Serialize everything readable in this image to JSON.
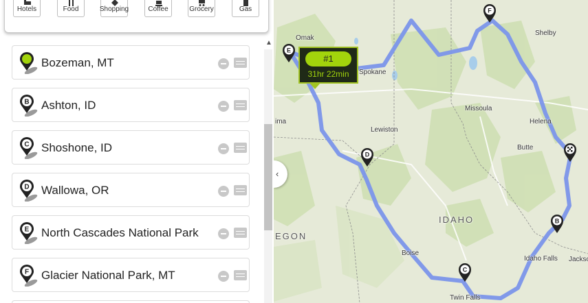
{
  "categories": [
    {
      "label": "Hotels",
      "icon": "bed-icon"
    },
    {
      "label": "Food",
      "icon": "fork-knife-icon"
    },
    {
      "label": "Shopping",
      "icon": "shopping-tag-icon"
    },
    {
      "label": "Coffee",
      "icon": "coffee-cup-icon"
    },
    {
      "label": "Grocery",
      "icon": "cart-icon"
    },
    {
      "label": "Gas",
      "icon": "gas-pump-icon"
    }
  ],
  "stops": [
    {
      "marker": "",
      "name": "Bozeman, MT"
    },
    {
      "marker": "B",
      "name": "Ashton, ID"
    },
    {
      "marker": "C",
      "name": "Shoshone, ID"
    },
    {
      "marker": "D",
      "name": "Wallowa, OR"
    },
    {
      "marker": "E",
      "name": "North Cascades National Park"
    },
    {
      "marker": "F",
      "name": "Glacier National Park, MT"
    }
  ],
  "map": {
    "labels": {
      "omak": "Omak",
      "spokane": "Spokane",
      "shelby": "Shelby",
      "missoula": "Missoula",
      "lewiston": "Lewiston",
      "helena": "Helena",
      "butte": "Butte",
      "idaho": "IDAHO",
      "oregon": "EGON",
      "boise": "Boise",
      "idaho_falls": "Idaho Falls",
      "jackson": "Jackso",
      "twin_falls": "Twin Falls",
      "yakima": "ima"
    },
    "route": {
      "label": "#1",
      "duration": "31hr 22min"
    },
    "colors": {
      "route": "#7b95ea",
      "accent": "#a2d40c",
      "land": "#e6ead8",
      "forest": "#cfe0b4"
    }
  }
}
